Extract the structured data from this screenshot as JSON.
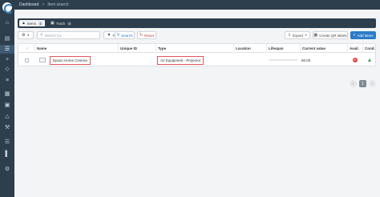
{
  "breadcrumb": {
    "home": "Dashboard",
    "separator": ">",
    "current": "Item search"
  },
  "tabs": [
    {
      "label": "Items",
      "count": "1",
      "icon": "items-icon"
    },
    {
      "label": "Trash",
      "count": "0",
      "icon": "trash-icon"
    }
  ],
  "toolbar": {
    "search_placeholder": "Search for...",
    "filter_label": "Filter by",
    "search_label": "Search",
    "reset_label": "Reset",
    "export_label": "Export",
    "qr_label": "Create QR labels",
    "add_label": "Add items"
  },
  "table": {
    "columns": [
      "Name",
      "Unique ID",
      "Type",
      "Location",
      "Lifespan",
      "Current value",
      "Avail.",
      "Cond."
    ],
    "rows": [
      {
        "name": "Epson Home Cinema",
        "unique_id": "",
        "type": "AV Equipment - Projector",
        "location": "",
        "lifespan": 0,
        "current_value": "€0.00",
        "available": false,
        "condition": "thumbs-up"
      }
    ]
  },
  "pagination": {
    "current": "1"
  },
  "colors": {
    "sidebar": "#2d3e4d",
    "primary": "#2b7cc8",
    "highlight": "#e2555a",
    "unavailable": "#d9443c",
    "good_condition": "#4aa35a"
  }
}
